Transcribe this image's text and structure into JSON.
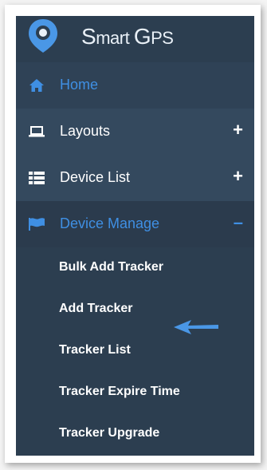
{
  "app": {
    "logo_text_s": "S",
    "logo_text_mart": "mart ",
    "logo_text_g": "G",
    "logo_text_ps": "PS"
  },
  "menu": {
    "home": {
      "label": "Home",
      "icon": "home-icon"
    },
    "layouts": {
      "label": "Layouts",
      "icon": "laptop-icon",
      "toggle": "+"
    },
    "device_list": {
      "label": "Device List",
      "icon": "list-icon",
      "toggle": "+"
    },
    "device_manage": {
      "label": "Device Manage",
      "icon": "flag-icon",
      "toggle": "–"
    }
  },
  "sub_menu": {
    "items": [
      {
        "label": "Bulk Add Tracker"
      },
      {
        "label": "Add Tracker"
      },
      {
        "label": "Tracker List"
      },
      {
        "label": "Tracker Expire Time"
      },
      {
        "label": "Tracker Upgrade"
      }
    ]
  },
  "colors": {
    "sidebar": "#2c3e50",
    "accent": "#3f8fe3",
    "annotation_arrow": "#4a97e6"
  }
}
